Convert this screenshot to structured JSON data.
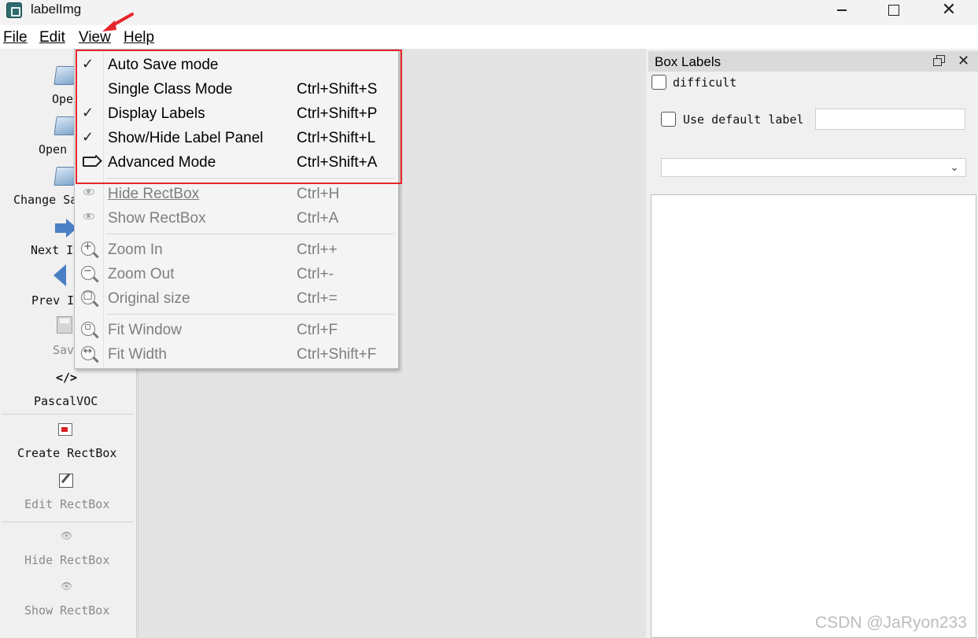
{
  "window": {
    "title": "labelImg",
    "controls": {
      "minimize": "minimize",
      "maximize": "maximize",
      "close": "close"
    }
  },
  "menubar": {
    "file": "File",
    "edit": "Edit",
    "view": "View",
    "help": "Help"
  },
  "toolbar": {
    "items": [
      {
        "label": "Ope",
        "icon": "folder-open-icon"
      },
      {
        "label": "Open",
        "icon": "folder-open-icon"
      },
      {
        "label": "Change Sa",
        "icon": "folder-open-icon"
      },
      {
        "label": "Next I",
        "icon": "arrow-right-icon"
      },
      {
        "label": "Prev I",
        "icon": "arrow-left-icon"
      },
      {
        "label": "Sav",
        "icon": "save-icon"
      },
      {
        "label": "PascalVOC",
        "icon": "code-icon",
        "glyph": "</>"
      },
      {
        "label": "Create RectBox",
        "icon": "create-rectbox-icon"
      },
      {
        "label": "Edit RectBox",
        "icon": "edit-rectbox-icon"
      },
      {
        "label": "Hide RectBox",
        "icon": "eye-icon"
      },
      {
        "label": "Show RectBox",
        "icon": "eye-icon"
      }
    ]
  },
  "view_menu": {
    "items": [
      {
        "label": "Auto Save mode",
        "shortcut": "",
        "checked": true,
        "enabled": true
      },
      {
        "label": "Single Class Mode",
        "shortcut": "Ctrl+Shift+S",
        "checked": false,
        "enabled": true
      },
      {
        "label": "Display Labels",
        "shortcut": "Ctrl+Shift+P",
        "checked": true,
        "enabled": true
      },
      {
        "label": "Show/Hide Label Panel",
        "shortcut": "Ctrl+Shift+L",
        "checked": true,
        "enabled": true
      },
      {
        "label": "Advanced Mode",
        "shortcut": "Ctrl+Shift+A",
        "icon": "tag-icon",
        "enabled": true
      },
      {
        "label": "Hide RectBox",
        "shortcut": "Ctrl+H",
        "icon": "eye-icon",
        "enabled": false
      },
      {
        "label": "Show RectBox",
        "shortcut": "Ctrl+A",
        "icon": "eye-icon",
        "enabled": false
      },
      {
        "label": "Zoom In",
        "shortcut": "Ctrl++",
        "icon": "zoom-in-icon",
        "enabled": false
      },
      {
        "label": "Zoom Out",
        "shortcut": "Ctrl+-",
        "icon": "zoom-out-icon",
        "enabled": false
      },
      {
        "label": "Original size",
        "shortcut": "Ctrl+=",
        "icon": "zoom-original-icon",
        "enabled": false
      },
      {
        "label": "Fit Window",
        "shortcut": "Ctrl+F",
        "icon": "fit-window-icon",
        "enabled": false
      },
      {
        "label": "Fit Width",
        "shortcut": "Ctrl+Shift+F",
        "icon": "fit-width-icon",
        "enabled": false
      }
    ]
  },
  "box_labels": {
    "title": "Box Labels",
    "difficult_label": "difficult",
    "use_default_label": "Use default label",
    "default_label_value": "",
    "combo_value": ""
  },
  "annotation": {
    "highlight_color": "#e5252a",
    "arrow_color": "#e5252a"
  },
  "watermark": "CSDN @JaRyon233"
}
